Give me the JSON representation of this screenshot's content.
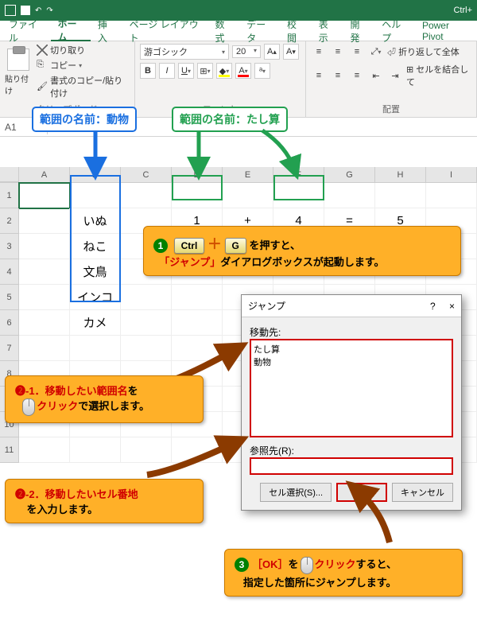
{
  "titlebar": {
    "right": "Ctrl+"
  },
  "tabs": {
    "file": "ファイル",
    "home": "ホーム",
    "insert": "挿入",
    "layout": "ページ レイアウト",
    "formula": "数式",
    "data": "データ",
    "review": "校閲",
    "view": "表示",
    "dev": "開発",
    "help": "ヘルプ",
    "pp": "Power Pivot"
  },
  "ribbon": {
    "paste": "貼り付け",
    "cut": "切り取り",
    "copy": "コピー",
    "fmtpaint": "書式のコピー/貼り付け",
    "clip": "クリップボード",
    "fontgrp": "フォント",
    "aligngrp": "配置",
    "fontname": "游ゴシック",
    "fontsize": "20",
    "wrap": "折り返して全体",
    "merge": "セルを結合して"
  },
  "namebox": "A1",
  "cols": [
    "A",
    "B",
    "C",
    "D",
    "E",
    "F",
    "G",
    "H",
    "I"
  ],
  "rows": [
    "1",
    "2",
    "3",
    "4",
    "5",
    "6",
    "7",
    "8",
    "9",
    "10",
    "11"
  ],
  "animals": [
    "いぬ",
    "ねこ",
    "文鳥",
    "インコ",
    "カメ"
  ],
  "math": {
    "a": "1",
    "op": "+",
    "b": "4",
    "eq": "=",
    "r": "5"
  },
  "labels": {
    "badge_blue": "範囲の名前：動物",
    "badge_green": "範囲の名前：たし算"
  },
  "callout1": {
    "pre": "を押すと、",
    "jump": "「ジャンプ」",
    "post": "ダイアログボックスが起動します。",
    "key1": "Ctrl",
    "key2": "G"
  },
  "callout21": {
    "num": "❷-1．",
    "a": "移動したい範囲名",
    "b": "を",
    "c": "クリック",
    "d": "で選択します。"
  },
  "callout22": {
    "num": "❷-2．",
    "a": "移動したいセル番地",
    "b": "を入力します。"
  },
  "callout3": {
    "a": "［OK］",
    "b": "を",
    "c": "クリック",
    "d": "すると、",
    "e": "指定した箇所にジャンプします。"
  },
  "dialog": {
    "title": "ジャンプ",
    "dest": "移動先:",
    "item1": "たし算",
    "item2": "動物",
    "ref": "参照先(R):",
    "btn_sel": "セル選択(S)...",
    "btn_ok": "OK",
    "btn_cancel": "キャンセル",
    "help": "?",
    "close": "×"
  }
}
